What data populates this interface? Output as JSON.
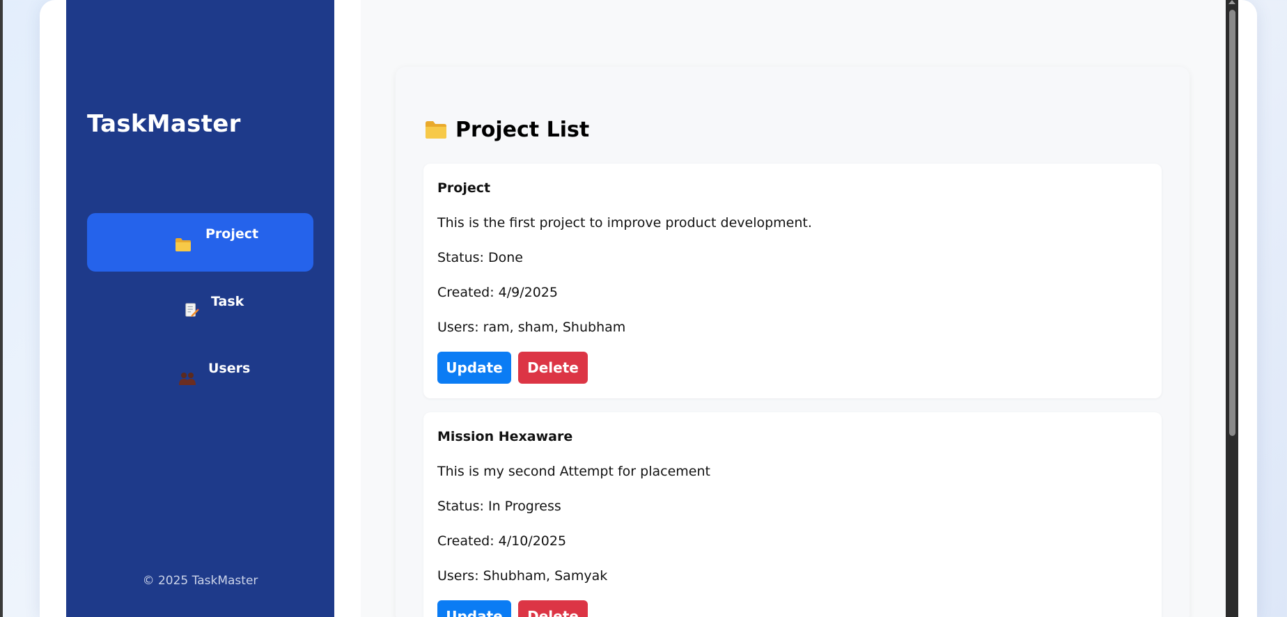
{
  "sidebar": {
    "brand": "TaskMaster",
    "items": [
      {
        "label": "Project",
        "icon": "folder-icon",
        "active": true
      },
      {
        "label": "Task",
        "icon": "memo-icon",
        "active": false
      },
      {
        "label": "Users",
        "icon": "users-icon",
        "active": false
      }
    ],
    "footer": "© 2025 TaskMaster"
  },
  "main": {
    "title": "Project List",
    "title_icon": "folder-icon",
    "projects": [
      {
        "name": "Project",
        "description": "This is the first project to improve product development.",
        "status": "Status: Done",
        "created": "Created: 4/9/2025",
        "users": "Users: ram, sham, Shubham",
        "update_label": "Update",
        "delete_label": "Delete"
      },
      {
        "name": "Mission Hexaware",
        "description": "This is my second Attempt for placement",
        "status": "Status: In Progress",
        "created": "Created: 4/10/2025",
        "users": "Users: Shubham, Samyak",
        "update_label": "Update",
        "delete_label": "Delete"
      }
    ]
  },
  "colors": {
    "sidebar_bg": "#1e3a8a",
    "active_item": "#2563eb",
    "update_button": "#0b7cf4",
    "delete_button": "#dc3545",
    "folder": "#f7c948"
  }
}
